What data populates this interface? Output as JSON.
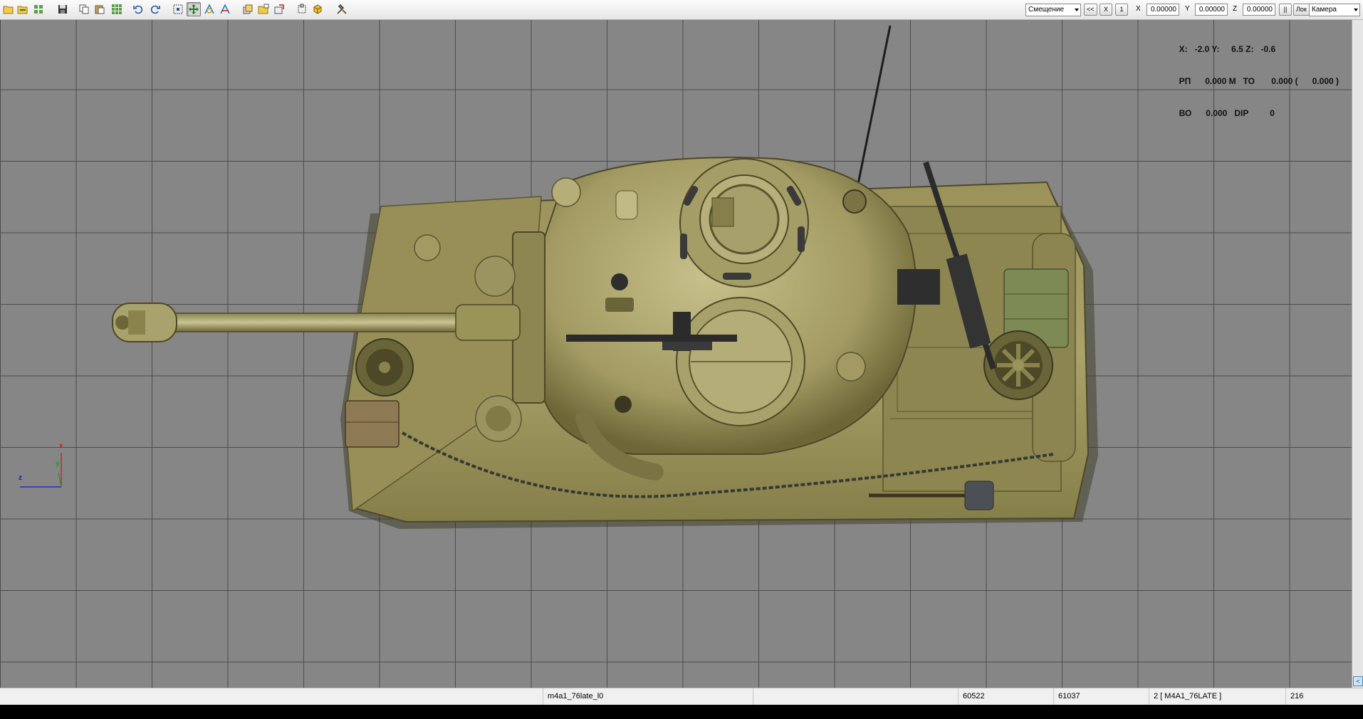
{
  "toolbar": {
    "mode_select": "Смещение",
    "btn_prev": "<<",
    "btn_x": "X",
    "btn_one": "1",
    "label_x": "X",
    "label_y": "Y",
    "label_z": "Z",
    "field_x": "0.00000",
    "field_y": "0.00000",
    "field_z": "0.00000",
    "btn_pause": "||",
    "btn_local": "Лок",
    "view_select": "Камера"
  },
  "hud": {
    "line1": "X:   -2.0 Y:     6.5 Z:   -0.6",
    "line2": "РП      0.000 М   ТО       0.000 (      0.000 )",
    "line3": "ВО      0.000   DIP         0"
  },
  "axes": {
    "x": "x",
    "y": "y",
    "z": "z"
  },
  "colors": {
    "axis_x": "#d01818",
    "axis_y": "#1aa01a",
    "axis_z": "#1a1ac8",
    "grid_bg": "#868686",
    "grid_line": "#4c4c4c"
  },
  "status": {
    "model_name": "m4a1_76late_l0",
    "value1": "60522",
    "value2": "61037",
    "object": "2 [ M4A1_76LATE ]",
    "value3": "216"
  }
}
